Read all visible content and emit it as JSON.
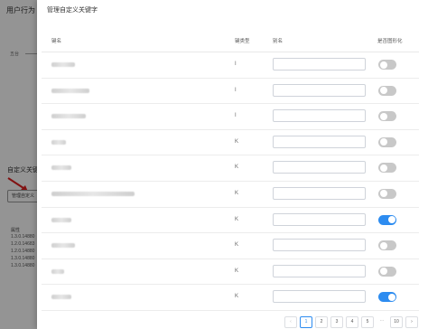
{
  "background": {
    "title": "用户行为",
    "pie_label": "五台",
    "custom_label": "自定义关键",
    "manage_button": "管理自定义",
    "table_head": "属性",
    "table_values": [
      "1.3.0.14880",
      "1.2.0.14683",
      "1.2.0.14880",
      "1.3.0.14880",
      "1.3.0.14880"
    ]
  },
  "drawer": {
    "title": "管理自定义关键字",
    "columns": {
      "key": "键名",
      "type": "键类型",
      "alias": "别名",
      "graphical": "是否图形化"
    },
    "rows": [
      {
        "type": "I",
        "alias": "",
        "graphical": false
      },
      {
        "type": "I",
        "alias": "",
        "graphical": false
      },
      {
        "type": "I",
        "alias": "",
        "graphical": false
      },
      {
        "type": "K",
        "alias": "",
        "graphical": false
      },
      {
        "type": "K",
        "alias": "",
        "graphical": false
      },
      {
        "type": "K",
        "alias": "",
        "graphical": false
      },
      {
        "type": "K",
        "alias": "",
        "graphical": true
      },
      {
        "type": "K",
        "alias": "",
        "graphical": false
      },
      {
        "type": "K",
        "alias": "",
        "graphical": false
      },
      {
        "type": "K",
        "alias": "",
        "graphical": true
      }
    ],
    "pagination": {
      "prev": "‹",
      "pages": [
        "1",
        "2",
        "3",
        "4",
        "5"
      ],
      "ellipsis": "···",
      "last": "10",
      "next": "›",
      "current": "1"
    }
  },
  "colors": {
    "accent": "#2d8cf0",
    "switch_off": "#c8c8c8",
    "mask": "rgba(0,0,0,0.42)"
  }
}
